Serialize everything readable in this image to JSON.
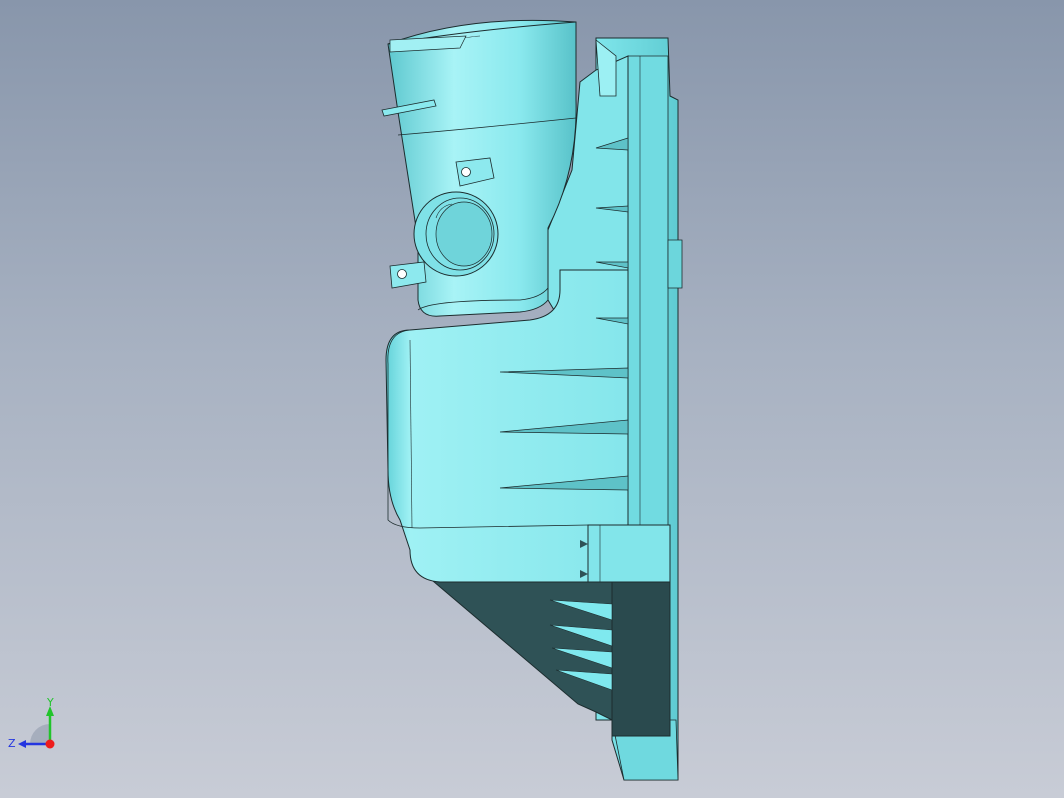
{
  "viewport": {
    "background_top": "#8896ab",
    "background_bottom": "#c8ccd6"
  },
  "model": {
    "part": "air-filter-housing",
    "face_color": "#7fe9ef",
    "shadow_color": "#2f5256",
    "edge_color": "#1c2c2e"
  },
  "triad": {
    "x_color": "#ee1c1c",
    "y_color": "#21c42b",
    "z_color": "#2436e0",
    "y_label": "Y",
    "z_label": "Z"
  }
}
